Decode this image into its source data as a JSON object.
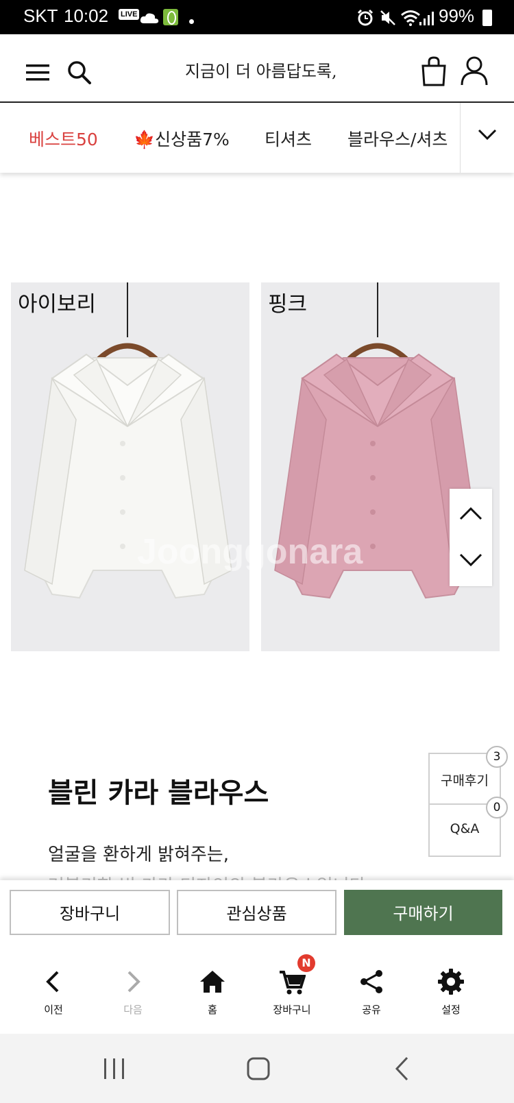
{
  "status_bar": {
    "carrier": "SKT",
    "time": "10:02",
    "live_badge": "LIVE",
    "battery": "99%"
  },
  "header": {
    "tagline": "지금이 더 아름답도록,"
  },
  "category_nav": {
    "items": [
      {
        "label": "베스트50",
        "color": "#d9413f"
      },
      {
        "label": "🍁신상품7%",
        "color": "#222222"
      },
      {
        "label": "티셔츠",
        "color": "#222222"
      },
      {
        "label": "블라우스/셔츠",
        "color": "#222222"
      }
    ]
  },
  "photos": [
    {
      "label": "아이보리",
      "color": "#f7f7f4"
    },
    {
      "label": "핑크",
      "color": "#dca5b3"
    }
  ],
  "watermark": "Joonggonara",
  "side_boxes": [
    {
      "label": "구매후기",
      "count": "3"
    },
    {
      "label": "Q&A",
      "count": "0"
    }
  ],
  "product": {
    "title": "블린 카라 블라우스",
    "desc_line1": "얼굴을 환하게 밝혀주는,",
    "desc_line2": "러블리한 빅 카라 디자인의 블라우스입니다"
  },
  "action_bar": {
    "cart": "장바구니",
    "wishlist": "관심상품",
    "buy": "구매하기",
    "buy_color": "#4f7550"
  },
  "bottom_nav": {
    "items": [
      {
        "label": "이전"
      },
      {
        "label": "다음"
      },
      {
        "label": "홈"
      },
      {
        "label": "장바구니",
        "badge": "N"
      },
      {
        "label": "공유"
      },
      {
        "label": "설정"
      }
    ]
  }
}
